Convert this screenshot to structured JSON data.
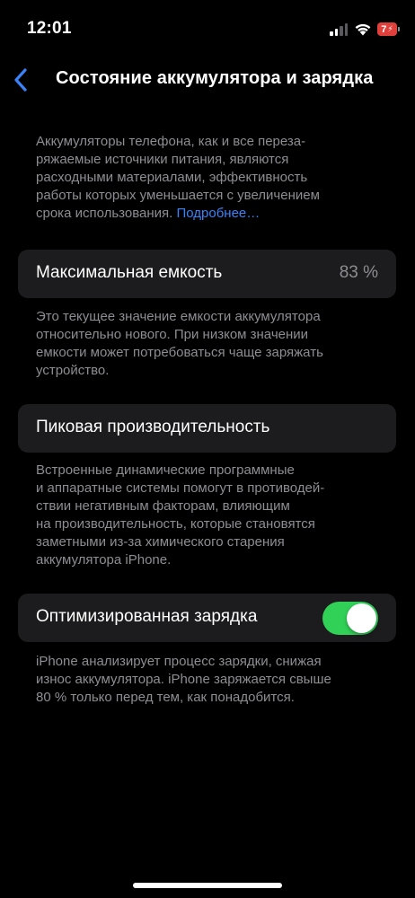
{
  "status_bar": {
    "time": "12:01",
    "battery_level": "7",
    "icons": [
      "signal-icon",
      "wifi-icon",
      "battery-icon"
    ]
  },
  "nav": {
    "back_icon": "chevron-left-icon",
    "title": "Состояние аккумулятора и зарядка"
  },
  "intro": {
    "text": "Аккумуляторы телефона, как и все переза-\nряжаемые источники питания, являются\nрасходными материалами, эффективность\nработы которых уменьшается с увеличением\nсрока использования. ",
    "link": "Подробнее…"
  },
  "max_capacity": {
    "label": "Максимальная емкость",
    "value": "83 %",
    "footer": "Это текущее значение емкости аккумулятора\nотносительно нового. При низком значении\nемкости может потребоваться чаще заряжать\nустройство."
  },
  "peak_performance": {
    "label": "Пиковая производительность",
    "footer": "Встроенные динамические программные\nи аппаратные системы помогут в противодей-\nствии негативным факторам, влияющим\nна производительность, которые становятся\nзаметными из-за химического старения\nаккумулятора iPhone."
  },
  "optimized_charging": {
    "label": "Оптимизированная зарядка",
    "enabled": true,
    "footer": "iPhone анализирует процесс зарядки, снижая\nизнос аккумулятора. iPhone заряжается свыше\n80 % только перед тем, как понадобится."
  },
  "colors": {
    "background": "#000000",
    "cell": "#1c1c1e",
    "secondary_text": "#8d8d92",
    "link": "#3b82f6",
    "toggle_on": "#31d158",
    "battery_low": "#e0403b"
  }
}
